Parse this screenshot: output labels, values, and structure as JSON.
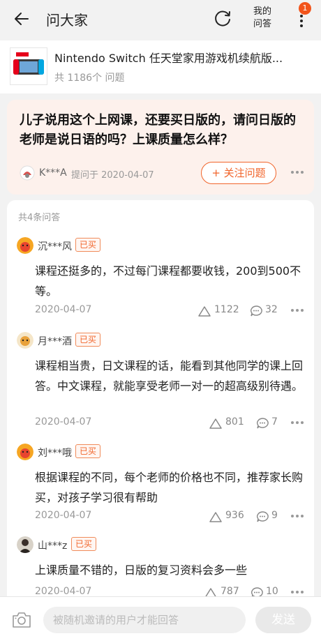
{
  "header": {
    "title": "问大家",
    "my_questions_line1": "我的",
    "my_questions_line2": "问答",
    "badge_count": "1",
    "icons": [
      "back-arrow-icon",
      "refresh-icon",
      "more-vertical-icon"
    ]
  },
  "product": {
    "title": "Nintendo Switch 任天堂家用游戏机续航版...",
    "count": "共 1186个 问题"
  },
  "question": {
    "text": "儿子说用这个上网课，还要买日版的，请问日版的老师是说日语的吗？上课质量怎么样？",
    "user": "K***A",
    "date": "提问于 2020-04-07",
    "follow_label": "+ 关注问题"
  },
  "answers_count": "共4条问答",
  "answers": [
    {
      "user": "沉***风",
      "badge": "已买",
      "text": "课程还挺多的，不过每门课程都要收钱，200到500不等。",
      "date": "2020-04-07",
      "likes": "1122",
      "comments": "32"
    },
    {
      "user": "月***酒",
      "badge": "已买",
      "text": "课程相当贵，日文课程的话，能看到其他同学的课上回答。中文课程，就能享受老师一对一的超高级别待遇。",
      "date": "2020-04-07",
      "likes": "801",
      "comments": "7"
    },
    {
      "user": "刘***哦",
      "badge": "已买",
      "text": "根据课程的不同，每个老师的价格也不同，推荐家长购买，对孩子学习很有帮助",
      "date": "2020-04-07",
      "likes": "936",
      "comments": "9"
    },
    {
      "user": "山***z",
      "badge": "已买",
      "text": "上课质量不错的，日版的复习资料会多一些",
      "date": "2020-04-07",
      "likes": "787",
      "comments": "10"
    }
  ],
  "bottom": {
    "placeholder": "被随机邀请的用户才能回答",
    "send_label": "发送"
  },
  "colors": {
    "accent": "#f1652b",
    "badge": "#f2541b",
    "question_bg": "#fdf1ec"
  }
}
